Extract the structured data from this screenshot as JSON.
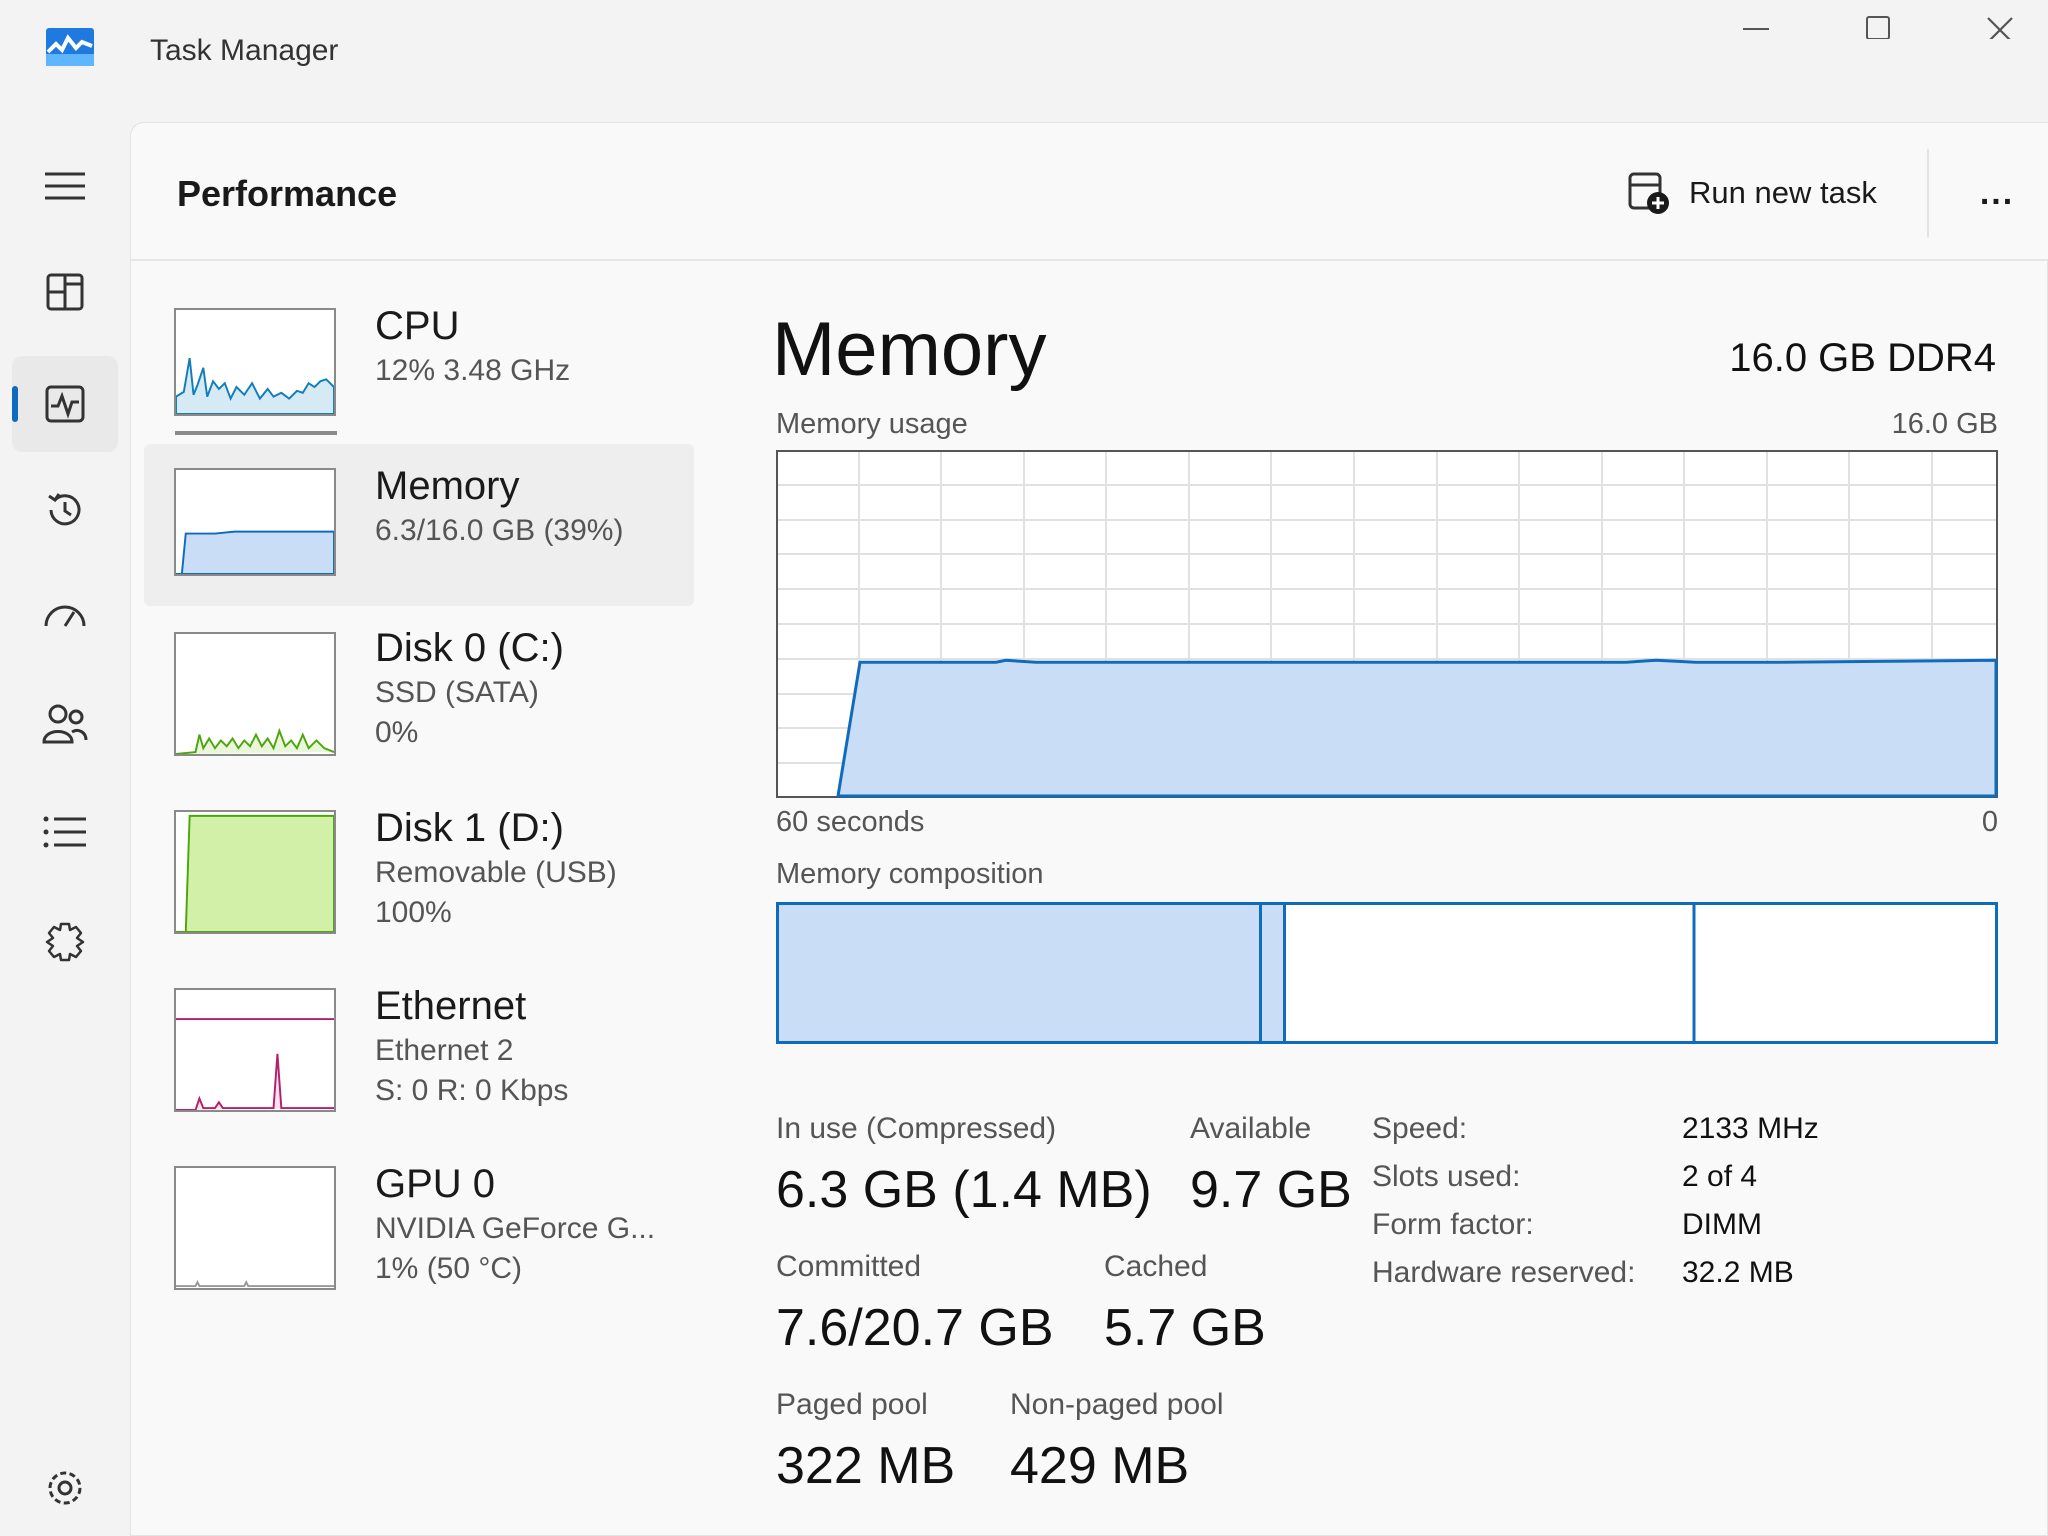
{
  "window": {
    "title": "Task Manager",
    "icons": [
      "task-manager-app-icon",
      "minimize-icon",
      "maximize-icon",
      "close-icon"
    ]
  },
  "nav": {
    "items": [
      {
        "icon": "hamburger-menu-icon"
      },
      {
        "icon": "processes-icon"
      },
      {
        "icon": "performance-icon",
        "active": true
      },
      {
        "icon": "app-history-icon"
      },
      {
        "icon": "startup-apps-icon"
      },
      {
        "icon": "users-icon"
      },
      {
        "icon": "details-icon"
      },
      {
        "icon": "services-icon"
      },
      {
        "icon": "settings-icon"
      }
    ]
  },
  "header": {
    "title": "Performance",
    "run_new_task": "Run new task",
    "more": "..."
  },
  "devices": [
    {
      "name": "CPU",
      "line1": "12%  3.48 GHz",
      "color": "#117dbb",
      "fill": "#d6eaf6"
    },
    {
      "name": "Memory",
      "line1": "6.3/16.0 GB (39%)",
      "selected": true,
      "color": "#0f6cbd",
      "fill": "#c9ddf7",
      "percent": 39
    },
    {
      "name": "Disk 0 (C:)",
      "line1": "SSD (SATA)",
      "line2": "0%",
      "color": "#4da60c",
      "fill": "#eaf6dc"
    },
    {
      "name": "Disk 1 (D:)",
      "line1": "Removable (USB)",
      "line2": "100%",
      "color": "#4da60c",
      "fill": "#d3f0a8",
      "percent": 100
    },
    {
      "name": "Ethernet",
      "line1": "Ethernet 2",
      "line2": "S: 0  R: 0 Kbps",
      "color": "#b4206b"
    },
    {
      "name": "GPU 0",
      "line1": "NVIDIA GeForce G...",
      "line2": "1%  (50 °C)",
      "color": "#999999"
    }
  ],
  "detail": {
    "title": "Memory",
    "spec": "16.0 GB DDR4",
    "usage_label": "Memory usage",
    "usage_max": "16.0 GB",
    "time_left": "60 seconds",
    "time_right": "0",
    "composition_label": "Memory composition",
    "usage_percent": 39,
    "stats": {
      "in_use_label": "In use (Compressed)",
      "in_use_value": "6.3 GB (1.4 MB)",
      "available_label": "Available",
      "available_value": "9.7 GB",
      "committed_label": "Committed",
      "committed_value": "7.6/20.7 GB",
      "cached_label": "Cached",
      "cached_value": "5.7 GB",
      "paged_label": "Paged pool",
      "paged_value": "322 MB",
      "nonpaged_label": "Non-paged pool",
      "nonpaged_value": "429 MB"
    },
    "props": [
      {
        "key": "Speed:",
        "value": "2133 MHz"
      },
      {
        "key": "Slots used:",
        "value": "2 of 4"
      },
      {
        "key": "Form factor:",
        "value": "DIMM"
      },
      {
        "key": "Hardware reserved:",
        "value": "32.2 MB"
      }
    ]
  }
}
